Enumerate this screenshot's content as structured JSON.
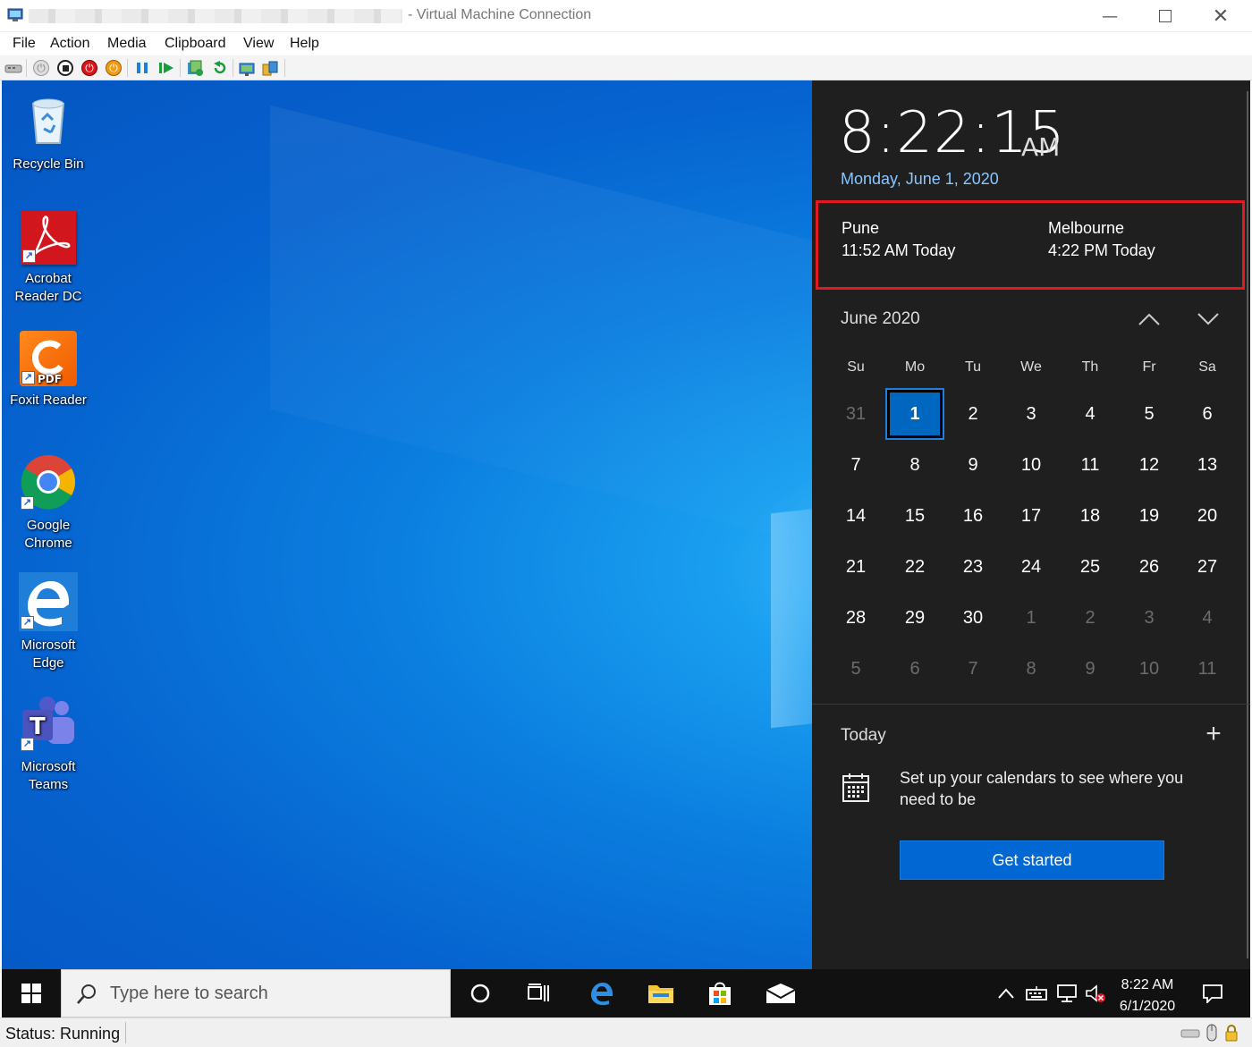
{
  "window": {
    "title": "- Virtual Machine Connection",
    "controls": [
      "minimize-icon",
      "maximize-icon",
      "close-icon"
    ]
  },
  "menu": [
    "File",
    "Action",
    "Media",
    "Clipboard",
    "View",
    "Help"
  ],
  "toolbar_icons": [
    "ctrl-alt-del-icon",
    "start-icon",
    "turn-off-icon",
    "shut-down-icon",
    "save-icon",
    "pause-icon",
    "resume-icon",
    "checkpoint-icon",
    "revert-icon",
    "enhanced-session-icon",
    "share-icon"
  ],
  "desktop": {
    "icons": [
      {
        "label": "Recycle Bin"
      },
      {
        "label": "Acrobat Reader DC"
      },
      {
        "label": "Foxit Reader"
      },
      {
        "label": "Google Chrome"
      },
      {
        "label": "Microsoft Edge"
      },
      {
        "label": "Microsoft Teams"
      }
    ]
  },
  "flyout": {
    "time": "8:22:15",
    "ampm": "AM",
    "date": "Monday, June 1, 2020",
    "clocks": [
      {
        "city": "Pune",
        "time": "11:52 AM Today"
      },
      {
        "city": "Melbourne",
        "time": "4:22 PM Today"
      }
    ],
    "month": "June 2020",
    "weekdays": [
      "Su",
      "Mo",
      "Tu",
      "We",
      "Th",
      "Fr",
      "Sa"
    ],
    "weeks": [
      [
        "31",
        "1",
        "2",
        "3",
        "4",
        "5",
        "6"
      ],
      [
        "7",
        "8",
        "9",
        "10",
        "11",
        "12",
        "13"
      ],
      [
        "14",
        "15",
        "16",
        "17",
        "18",
        "19",
        "20"
      ],
      [
        "21",
        "22",
        "23",
        "24",
        "25",
        "26",
        "27"
      ],
      [
        "28",
        "29",
        "30",
        "1",
        "2",
        "3",
        "4"
      ],
      [
        "5",
        "6",
        "7",
        "8",
        "9",
        "10",
        "11"
      ]
    ],
    "today_label": "Today",
    "setup_text": "Set up your calendars to see where you need to be",
    "get_started": "Get started"
  },
  "taskbar": {
    "search_placeholder": "Type here to search",
    "clock_time": "8:22 AM",
    "clock_date": "6/1/2020"
  },
  "status": "Status: Running",
  "colors": {
    "accent": "#0067c0",
    "highlight_border": "#e11a22",
    "flyout_bg": "#1f1f1f",
    "date_link": "#8ac6ff"
  }
}
